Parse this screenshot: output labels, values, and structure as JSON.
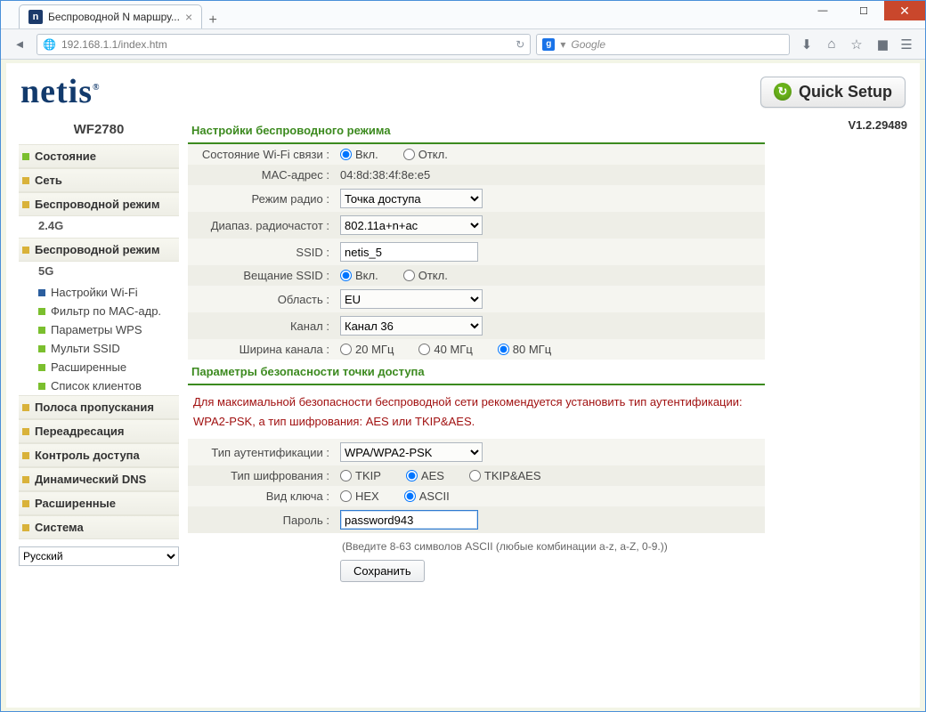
{
  "browser": {
    "tab_title": "Беспроводной N маршру...",
    "favicon_letter": "n",
    "url": "192.168.1.1/index.htm",
    "search_placeholder": "Google",
    "search_badge": "g"
  },
  "header": {
    "logo_text": "netis",
    "quick_setup_label": "Quick Setup",
    "model": "WF2780",
    "firmware_version": "V1.2.29489"
  },
  "sidebar": {
    "items": [
      {
        "label": "Состояние",
        "color": "green"
      },
      {
        "label": "Сеть",
        "color": "orange"
      },
      {
        "label": "Беспроводной режим",
        "color": "orange",
        "band": "2.4G"
      },
      {
        "label": "Беспроводной режим",
        "color": "orange",
        "band": "5G",
        "children": [
          {
            "label": "Настройки Wi-Fi",
            "color": "blue"
          },
          {
            "label": "Фильтр по MAC-адр.",
            "color": "green"
          },
          {
            "label": "Параметры WPS",
            "color": "green"
          },
          {
            "label": "Мульти SSID",
            "color": "green"
          },
          {
            "label": "Расширенные",
            "color": "green"
          },
          {
            "label": "Список клиентов",
            "color": "green"
          }
        ]
      },
      {
        "label": "Полоса пропускания",
        "color": "orange"
      },
      {
        "label": "Переадресация",
        "color": "orange"
      },
      {
        "label": "Контроль доступа",
        "color": "orange"
      },
      {
        "label": "Динамический DNS",
        "color": "orange"
      },
      {
        "label": "Расширенные",
        "color": "orange"
      },
      {
        "label": "Система",
        "color": "orange"
      }
    ],
    "language_value": "Русский"
  },
  "form": {
    "wifi_section_title": "Настройки беспроводного режима",
    "labels": {
      "radio_state": "Состояние Wi-Fi связи :",
      "mac": "MAC-адрес :",
      "radio_mode": "Режим радио :",
      "band": "Диапаз. радиочастот :",
      "ssid": "SSID :",
      "broadcast": "Вещание SSID :",
      "region": "Область :",
      "channel": "Канал :",
      "width": "Ширина канала :"
    },
    "on_label": "Вкл.",
    "off_label": "Откл.",
    "mac_value": "04:8d:38:4f:8e:e5",
    "radio_mode_value": "Точка доступа",
    "band_value": "802.11a+n+ac",
    "ssid_value": "netis_5",
    "region_value": "EU",
    "channel_value": "Канал 36",
    "width_20": "20 МГц",
    "width_40": "40 МГц",
    "width_80": "80 МГц",
    "sec_section_title": "Параметры безопасности точки доступа",
    "advice": "Для максимальной безопасности беспроводной сети рекомендуется установить тип аутентификации: WPA2-PSK, а тип шифрования: AES или TKIP&AES.",
    "labels_sec": {
      "auth": "Тип аутентификации :",
      "cipher": "Тип шифрования :",
      "keytype": "Вид ключа :",
      "password": "Пароль :"
    },
    "auth_value": "WPA/WPA2-PSK",
    "cipher_tkip": "TKIP",
    "cipher_aes": "AES",
    "cipher_both": "TKIP&AES",
    "key_hex": "HEX",
    "key_ascii": "ASCII",
    "password_value": "password943",
    "password_hint": "(Введите 8-63 символов ASCII (любые комбинации a-z, a-Z, 0-9.))",
    "save_label": "Сохранить"
  }
}
